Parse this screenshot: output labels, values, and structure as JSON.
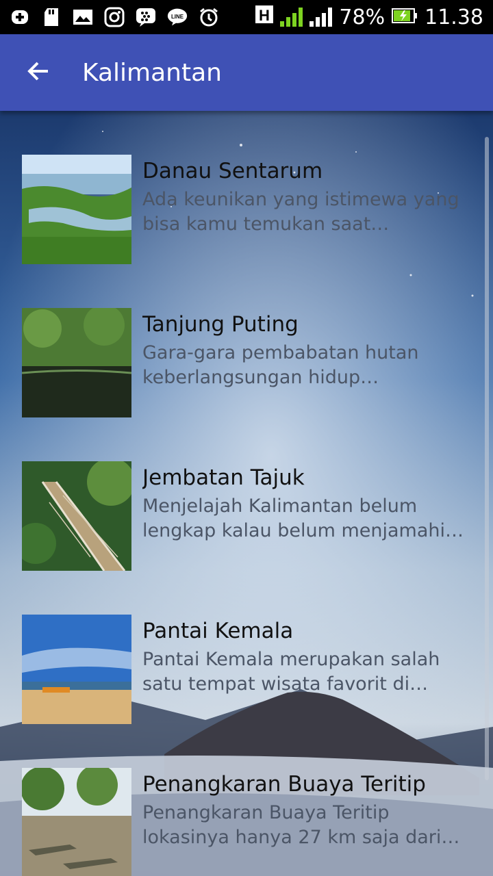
{
  "status_bar": {
    "battery": "78%",
    "time": "11.38",
    "icons": [
      "add-box-icon",
      "sd-card-icon",
      "gallery-icon",
      "instagram-icon",
      "blackberry-messenger-icon",
      "line-icon",
      "alarm-icon",
      "hspa-icon",
      "signal-sim1-icon",
      "signal-sim2-icon",
      "battery-charging-icon"
    ]
  },
  "appbar": {
    "title": "Kalimantan",
    "back_icon": "arrow-back-icon"
  },
  "items": [
    {
      "title": "Danau Sentarum",
      "desc": "Ada keunikan yang istimewa yang bisa kamu temukan saat…"
    },
    {
      "title": "Tanjung Puting",
      "desc": "Gara-gara pembabatan hutan keberlangsungan hidup…"
    },
    {
      "title": "Jembatan Tajuk",
      "desc": "Menjelajah Kalimantan belum lengkap kalau belum menjamahi…"
    },
    {
      "title": "Pantai Kemala",
      "desc": "Pantai Kemala merupakan salah satu tempat wisata favorit di…"
    },
    {
      "title": "Penangkaran Buaya Teritip",
      "desc": "Penangkaran Buaya Teritip lokasinya hanya 27 km saja dari…"
    }
  ],
  "colors": {
    "appbar": "#3f51b5",
    "status_bar": "#000000"
  }
}
